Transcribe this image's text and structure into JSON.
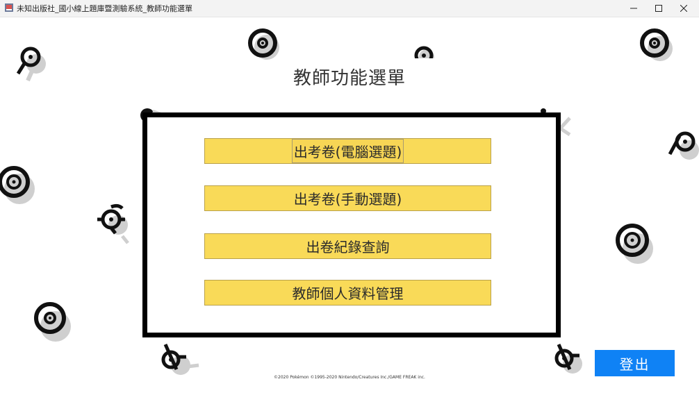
{
  "window": {
    "title": "未知出版社_國小線上題庫暨測驗系統_教師功能選單"
  },
  "page": {
    "title": "教師功能選單"
  },
  "menu": {
    "items": [
      {
        "label": "出考卷(電腦選題)"
      },
      {
        "label": "出考卷(手動選題)"
      },
      {
        "label": "出卷紀錄查詢"
      },
      {
        "label": "教師個人資料管理"
      }
    ]
  },
  "logout": {
    "label": "登出"
  },
  "footer": {
    "copyright": "©2020 Pokémon  ©1995-2020 Nintendo/Creatures Inc./GAME FREAK inc."
  },
  "colors": {
    "menu_button": "#f9da58",
    "logout_button": "#0f82f5",
    "panel_border": "#000000"
  },
  "icons": {
    "window_controls": [
      "minimize-icon",
      "maximize-icon",
      "close-icon"
    ],
    "decor": "unown-icon"
  }
}
